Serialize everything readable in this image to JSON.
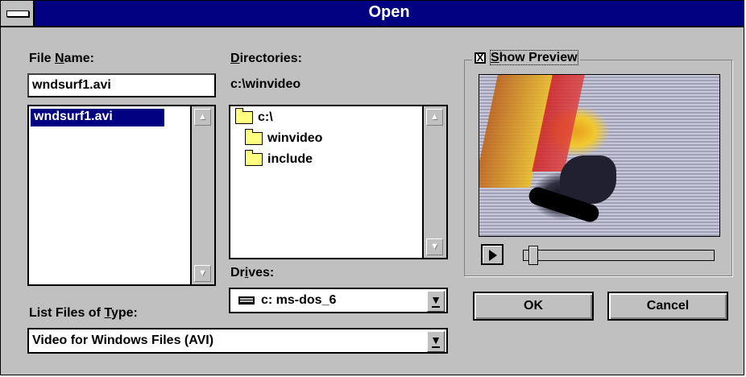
{
  "window": {
    "title": "Open"
  },
  "file_name": {
    "label_pre": "File ",
    "label_ul": "N",
    "label_post": "ame:",
    "value": "wndsurf1.avi",
    "list": [
      "wndsurf1.avi"
    ]
  },
  "directories": {
    "label_ul": "D",
    "label_post": "irectories:",
    "current_path": "c:\\winvideo",
    "tree": [
      {
        "label": "c:\\",
        "icon": "open-folder-icon"
      },
      {
        "label": "winvideo",
        "icon": "open-folder-icon"
      },
      {
        "label": "include",
        "icon": "folder-icon"
      }
    ]
  },
  "file_type": {
    "label_pre": "List Files of ",
    "label_ul": "T",
    "label_post": "ype:",
    "value": "Video for Windows Files (AVI)"
  },
  "drives": {
    "label_pre": "Dr",
    "label_ul": "i",
    "label_post": "ves:",
    "value": "c: ms-dos_6",
    "icon": "drive-icon"
  },
  "preview": {
    "checkbox_mark": "X",
    "label_ul": "S",
    "label_post": "how Preview",
    "checked": true,
    "position": 0.07
  },
  "buttons": {
    "ok": "OK",
    "cancel": "Cancel"
  },
  "icons": {
    "scroll_up": "▲",
    "scroll_down": "▼",
    "dropdown": "▼"
  }
}
